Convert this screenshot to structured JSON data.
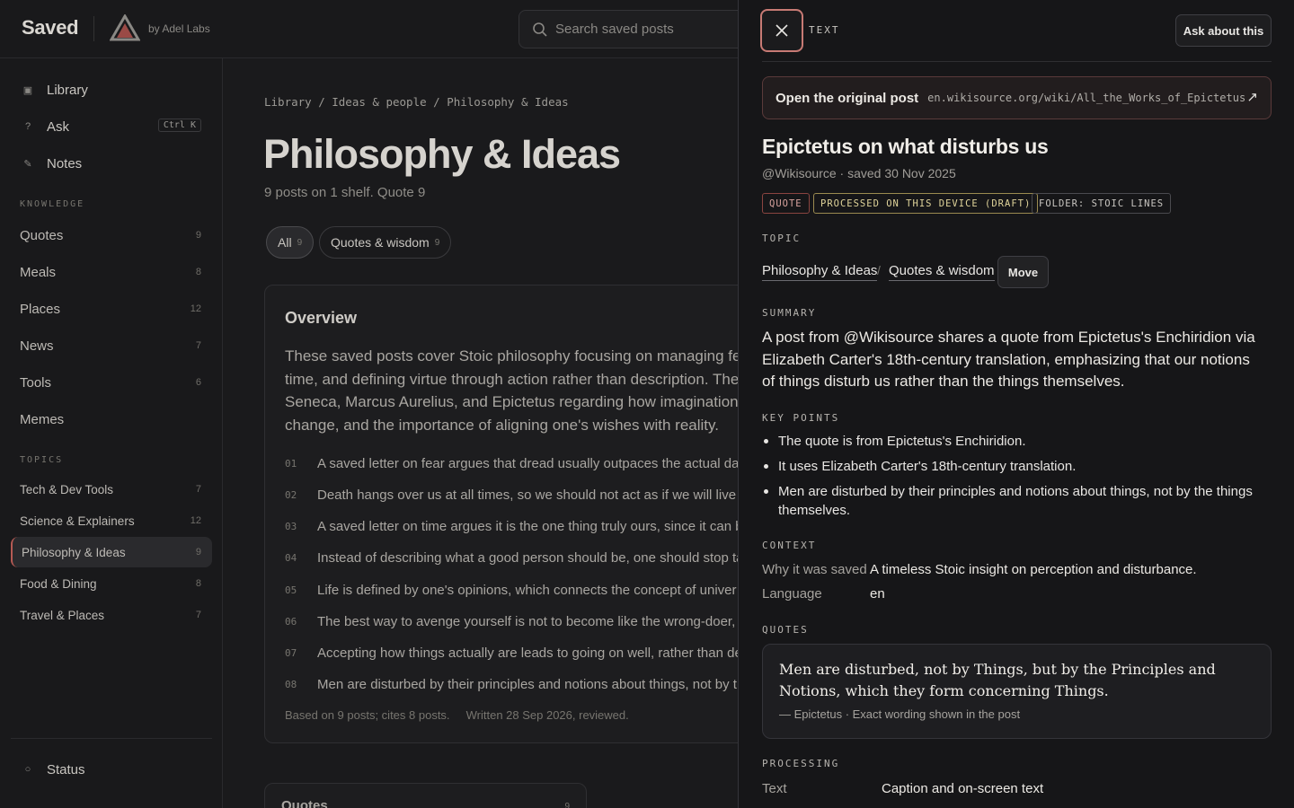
{
  "app": {
    "name": "Saved",
    "byline": "by Adel Labs"
  },
  "search": {
    "placeholder": "Search saved posts"
  },
  "nav": [
    {
      "label": "Library",
      "icon": "library-icon"
    },
    {
      "label": "Ask",
      "icon": "question-icon",
      "shortcut": "Ctrl K"
    },
    {
      "label": "Notes",
      "icon": "pencil-icon"
    }
  ],
  "knowledge": {
    "title": "KNOWLEDGE",
    "items": [
      {
        "label": "Quotes",
        "count": "9"
      },
      {
        "label": "Meals",
        "count": "8"
      },
      {
        "label": "Places",
        "count": "12"
      },
      {
        "label": "News",
        "count": "7"
      },
      {
        "label": "Tools",
        "count": "6"
      },
      {
        "label": "Memes",
        "count": ""
      }
    ]
  },
  "topics": {
    "title": "TOPICS",
    "items": [
      {
        "label": "Tech & Dev Tools",
        "count": "7"
      },
      {
        "label": "Science & Explainers",
        "count": "12"
      },
      {
        "label": "Philosophy & Ideas",
        "count": "9",
        "active": true
      },
      {
        "label": "Food & Dining",
        "count": "8"
      },
      {
        "label": "Travel & Places",
        "count": "7"
      }
    ]
  },
  "status": {
    "label": "Status"
  },
  "main": {
    "breadcrumb": "Library / Ideas & people / Philosophy & Ideas",
    "title": "Philosophy & Ideas",
    "subtitle": "9 posts on 1 shelf. Quote 9",
    "pills": [
      {
        "label": "All",
        "count": "9"
      },
      {
        "label": "Quotes & wisdom",
        "count": "9"
      }
    ],
    "overview": {
      "title": "Overview",
      "lines": [
        "These saved posts cover Stoic philosophy focusing on managing fear,",
        "time, and defining virtue through action rather than description. The",
        "Seneca, Marcus Aurelius, and Epictetus regarding how imagination a",
        "change, and the importance of aligning one's wishes with reality."
      ],
      "points": [
        {
          "num": "01",
          "text": "A saved letter on fear argues that dread usually outpaces the actual da"
        },
        {
          "num": "02",
          "text": "Death hangs over us at all times, so we should not act as if we will live fo"
        },
        {
          "num": "03",
          "text": "A saved letter on time argues it is the one thing truly ours, since it can b"
        },
        {
          "num": "04",
          "text": "Instead of describing what a good person should be, one should stop ta"
        },
        {
          "num": "05",
          "text": "Life is defined by one's opinions, which connects the concept of univer"
        },
        {
          "num": "06",
          "text": "The best way to avenge yourself is not to become like the wrong-doer,"
        },
        {
          "num": "07",
          "text": "Accepting how things actually are leads to going on well, rather than de"
        },
        {
          "num": "08",
          "text": "Men are disturbed by their principles and notions about things, not by t"
        }
      ],
      "footer": "Based on 9 posts; cites 8 posts.     Written 28 Sep 2026, reviewed."
    },
    "quotes_card": {
      "title": "Quotes",
      "count": "9"
    }
  },
  "panel": {
    "type_label": "TEXT",
    "ask_label": "Ask about this",
    "original_label": "Open the original post",
    "original_url": "en.wikisource.org/wiki/All_the_Works_of_Epictetus",
    "title": "Epictetus on what disturbs us",
    "meta": "@Wikisource · saved 30 Nov 2025",
    "tags": [
      "QUOTE",
      "PROCESSED ON THIS DEVICE (DRAFT)",
      "FOLDER: STOIC LINES"
    ],
    "topic_label": "TOPIC",
    "topic_path": [
      "Philosophy & Ideas",
      "Quotes & wisdom"
    ],
    "topic_sep": "/",
    "move_label": "Move",
    "summary_label": "SUMMARY",
    "summary": "A post from @Wikisource shares a quote from Epictetus's Enchiridion via Elizabeth Carter's 18th-century translation, emphasizing that our notions of things disturb us rather than the things themselves.",
    "key_points_label": "KEY POINTS",
    "key_points": [
      "The quote is from Epictetus's Enchiridion.",
      "It uses Elizabeth Carter's 18th-century translation.",
      "Men are disturbed by their principles and notions about things, not by the things themselves."
    ],
    "context_label": "CONTEXT",
    "context": [
      {
        "key": "Why it was saved",
        "value": "A timeless Stoic insight on perception and disturbance."
      },
      {
        "key": "Language",
        "value": "en"
      }
    ],
    "quotes_label": "QUOTES",
    "quote_text": "Men are disturbed, not by Things, but by the Principles and Notions, which they form concerning Things.",
    "quote_attr": "— Epictetus · Exact wording shown in the post",
    "processing_label": "PROCESSING",
    "processing": {
      "key": "Text",
      "value": "Caption and on-screen text"
    }
  },
  "colors": {
    "accent": "#b65a54",
    "background": "#1a1a1c",
    "panel": "#161618"
  }
}
